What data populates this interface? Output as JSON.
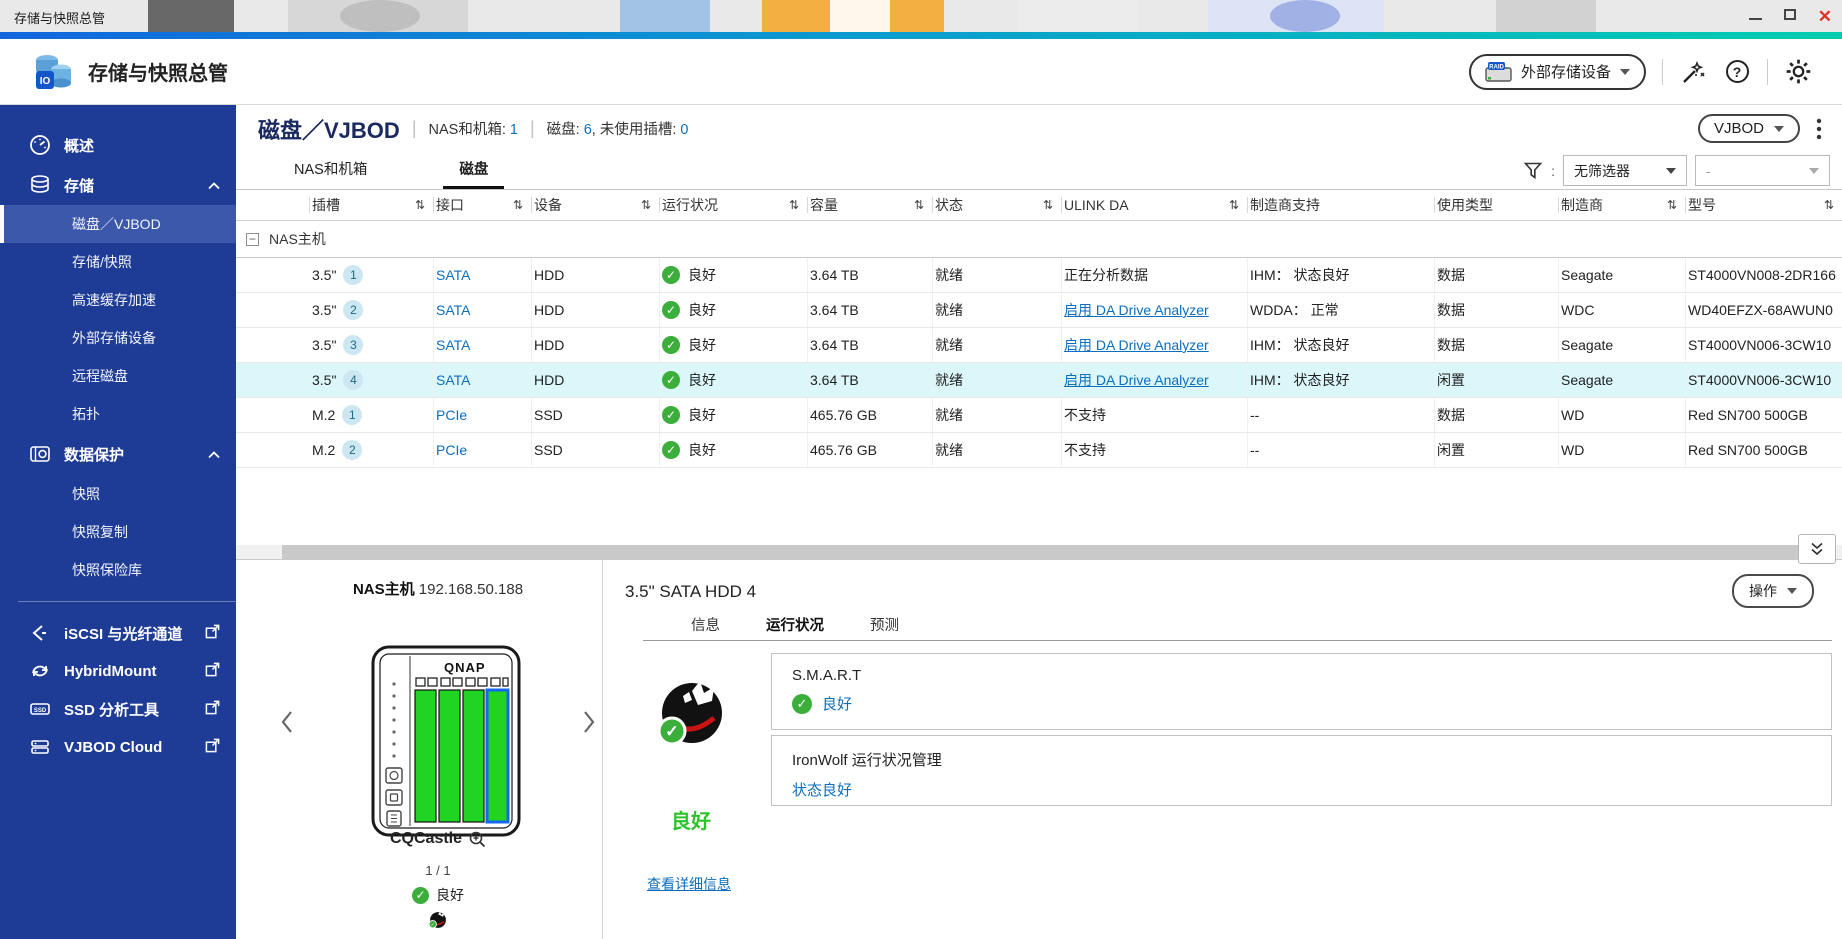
{
  "window": {
    "title": "存储与快照总管"
  },
  "header": {
    "app_title": "存储与快照总管",
    "external_device_button": "外部存储设备",
    "device_icon_label": "RAID"
  },
  "sidebar": {
    "overview": "概述",
    "storage_group": "存储",
    "storage_items": [
      "磁盘／VJBOD",
      "存储/快照",
      "高速缓存加速",
      "外部存储设备",
      "远程磁盘",
      "拓扑"
    ],
    "protection_group": "数据保护",
    "protection_items": [
      "快照",
      "快照复制",
      "快照保险库"
    ],
    "external_items": [
      "iSCSI 与光纤通道",
      "HybridMount",
      "SSD 分析工具",
      "VJBOD Cloud"
    ]
  },
  "page": {
    "title": "磁盘／VJBOD",
    "stats": [
      {
        "label": "NAS和机箱:",
        "value": "1"
      },
      {
        "label": "磁盘:",
        "value": "6"
      },
      {
        "label": ", 未使用插槽:",
        "value": "0"
      }
    ],
    "vjbod_button": "VJBOD",
    "tabs": [
      {
        "label": "NAS和机箱"
      },
      {
        "label": "磁盘"
      }
    ],
    "filter_primary": "无筛选器",
    "filter_secondary": "-"
  },
  "table": {
    "columns": [
      "插槽",
      "接口",
      "设备",
      "运行状况",
      "容量",
      "状态",
      "ULINK DA",
      "制造商支持",
      "使用类型",
      "制造商",
      "型号"
    ],
    "group_label": "NAS主机",
    "rows": [
      {
        "slot": "3.5\"",
        "num": "1",
        "interface": "SATA",
        "device": "HDD",
        "health": "良好",
        "capacity": "3.64 TB",
        "status": "就绪",
        "ulink": "正在分析数据",
        "support": "IHM： 状态良好",
        "usage": "数据",
        "vendor": "Seagate",
        "model": "ST4000VN008-2DR166"
      },
      {
        "slot": "3.5\"",
        "num": "2",
        "interface": "SATA",
        "device": "HDD",
        "health": "良好",
        "capacity": "3.64 TB",
        "status": "就绪",
        "ulink": "启用 DA Drive Analyzer",
        "support": "WDDA： 正常",
        "usage": "数据",
        "vendor": "WDC",
        "model": "WD40EFZX-68AWUN0"
      },
      {
        "slot": "3.5\"",
        "num": "3",
        "interface": "SATA",
        "device": "HDD",
        "health": "良好",
        "capacity": "3.64 TB",
        "status": "就绪",
        "ulink": "启用 DA Drive Analyzer",
        "support": "IHM： 状态良好",
        "usage": "数据",
        "vendor": "Seagate",
        "model": "ST4000VN006-3CW10"
      },
      {
        "slot": "3.5\"",
        "num": "4",
        "interface": "SATA",
        "device": "HDD",
        "health": "良好",
        "capacity": "3.64 TB",
        "status": "就绪",
        "ulink": "启用 DA Drive Analyzer",
        "support": "IHM： 状态良好",
        "usage": "闲置",
        "vendor": "Seagate",
        "model": "ST4000VN006-3CW10"
      },
      {
        "slot": "M.2",
        "num": "1",
        "interface": "PCIe",
        "device": "SSD",
        "health": "良好",
        "capacity": "465.76 GB",
        "status": "就绪",
        "ulink": "不支持",
        "support": "--",
        "usage": "数据",
        "vendor": "WD",
        "model": "Red SN700 500GB"
      },
      {
        "slot": "M.2",
        "num": "2",
        "interface": "PCIe",
        "device": "SSD",
        "health": "良好",
        "capacity": "465.76 GB",
        "status": "就绪",
        "ulink": "不支持",
        "support": "--",
        "usage": "闲置",
        "vendor": "WD",
        "model": "Red SN700 500GB"
      }
    ]
  },
  "bottom": {
    "nas_title": "NAS主机",
    "nas_ip": "192.168.50.188",
    "nas_name": "CQCastle",
    "pager": "1 / 1",
    "nas_health": "良好",
    "device_brand": "QNAP"
  },
  "detail": {
    "title": "3.5\" SATA HDD 4",
    "action_button": "操作",
    "tabs": [
      "信息",
      "运行状况",
      "预测"
    ],
    "overall_health": "良好",
    "smart_title": "S.M.A.R.T",
    "smart_status": "良好",
    "ironwolf_title": "IronWolf 运行状况管理",
    "ironwolf_status": "状态良好",
    "details_link": "查看详细信息"
  },
  "colors": {
    "accent_blue": "#0d6ebd",
    "health_green": "#3cae3c",
    "sidebar_blue": "#1e3c96",
    "selected_row": "#dcf7fa",
    "gradient_start": "#1266dd",
    "gradient_end": "#00cdb0"
  }
}
